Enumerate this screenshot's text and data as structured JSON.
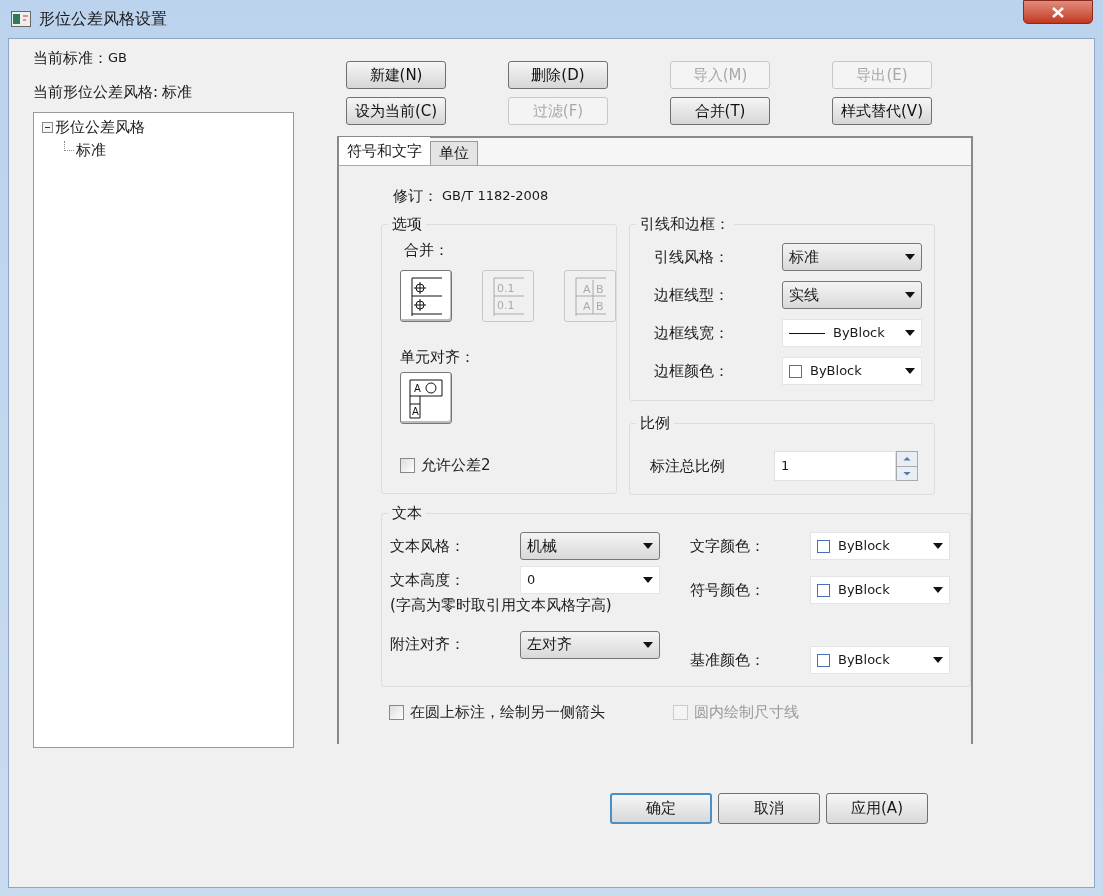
{
  "window": {
    "title": "形位公差风格设置"
  },
  "current_standard": {
    "label": "当前标准：",
    "value": "GB"
  },
  "current_style": {
    "label": "当前形位公差风格:",
    "value": "标准"
  },
  "tree": [
    {
      "label": "形位公差风格",
      "expanded": true,
      "children": [
        {
          "label": "标准",
          "selected": false
        }
      ]
    }
  ],
  "toolbar_buttons": [
    {
      "label": "新建(N)",
      "disabled": false
    },
    {
      "label": "删除(D)",
      "disabled": false
    },
    {
      "label": "导入(M)",
      "disabled": true
    },
    {
      "label": "导出(E)",
      "disabled": true
    },
    {
      "label": "设为当前(C)",
      "disabled": false
    },
    {
      "label": "过滤(F)",
      "disabled": true
    },
    {
      "label": "合并(T)",
      "disabled": false
    },
    {
      "label": "样式替代(V)",
      "disabled": false
    }
  ],
  "tabs": [
    {
      "label": "符号和文字",
      "selected": true
    },
    {
      "label": "单位",
      "selected": false
    }
  ],
  "revision": {
    "label": "修订：",
    "value": "GB/T 1182-2008"
  },
  "options": {
    "title": "选项",
    "merge_label": "合并：",
    "merge_buttons": [
      {
        "kind": "symbols",
        "disabled": false
      },
      {
        "kind": "values",
        "texts": [
          "0.1",
          "0.1"
        ],
        "disabled": true
      },
      {
        "kind": "letters",
        "texts": [
          "A",
          "B",
          "A",
          "B"
        ],
        "disabled": true
      }
    ],
    "align_label": "单元对齐：",
    "align_button": {
      "texts": [
        "A",
        "A"
      ]
    },
    "checkbox": {
      "label": "允许公差2",
      "checked": false
    }
  },
  "leader_frame": {
    "title": "引线和边框：",
    "rows": [
      {
        "label": "引线风格：",
        "kind": "dropdown",
        "value": "标准"
      },
      {
        "label": "边框线型：",
        "kind": "dropdown",
        "value": "实线"
      },
      {
        "label": "边框线宽：",
        "kind": "lineweight",
        "value": "ByBlock"
      },
      {
        "label": "边框颜色：",
        "kind": "color",
        "value": "ByBlock"
      }
    ]
  },
  "scale": {
    "title": "比例",
    "label": "标注总比例",
    "value": "1"
  },
  "text": {
    "title": "文本",
    "left": [
      {
        "label": "文本风格：",
        "kind": "dropdown",
        "value": "机械"
      },
      {
        "label": "文本高度：",
        "kind": "combo",
        "value": "0",
        "note": "(字高为零时取引用文本风格字高)"
      },
      {
        "label": "附注对齐：",
        "kind": "dropdown",
        "value": "左对齐"
      }
    ],
    "right": [
      {
        "label": "文字颜色：",
        "value": "ByBlock"
      },
      {
        "label": "符号颜色：",
        "value": "ByBlock"
      },
      {
        "label": "基准颜色：",
        "value": "ByBlock"
      }
    ]
  },
  "bottom_checkboxes": [
    {
      "label": "在圆上标注，绘制另一侧箭头",
      "checked": false,
      "disabled": false
    },
    {
      "label": "圆内绘制尺寸线",
      "checked": false,
      "disabled": true
    }
  ],
  "buttons": [
    {
      "label": "确定",
      "default": true
    },
    {
      "label": "取消",
      "default": false
    },
    {
      "label": "应用(A)",
      "default": false
    }
  ]
}
